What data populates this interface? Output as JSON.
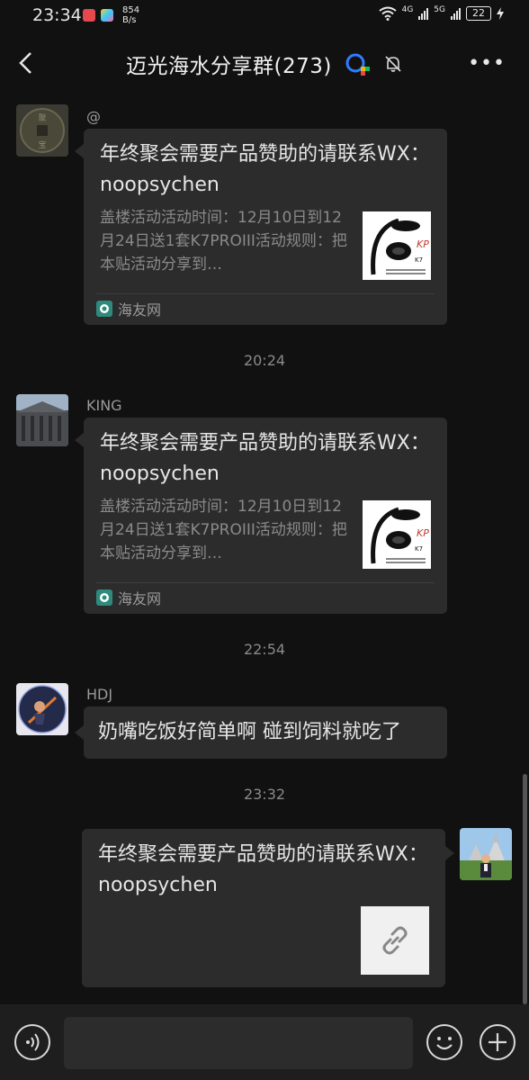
{
  "status": {
    "time": "23:34",
    "net_speed_value": "854",
    "net_speed_unit": "B/s",
    "sig1": "4G",
    "sig2": "5G",
    "battery": "22"
  },
  "header": {
    "title": "迈光海水分享群(273)"
  },
  "messages": [
    {
      "nick": "@",
      "card_title": "年终聚会需要产品赞助的请联系WX：noopsychen",
      "card_desc": "盖楼活动活动时间：12月10日到12月24日送1套K7PROIII活动规则：把本贴活动分享到…",
      "source": "海友网"
    },
    {
      "timestamp": "20:24",
      "nick": "KING",
      "card_title": "年终聚会需要产品赞助的请联系WX：noopsychen",
      "card_desc": "盖楼活动活动时间：12月10日到12月24日送1套K7PROIII活动规则：把本贴活动分享到…",
      "source": "海友网"
    },
    {
      "timestamp": "22:54",
      "nick": "HDJ",
      "text": "奶嘴吃饭好简单啊 碰到饲料就吃了"
    },
    {
      "timestamp": "23:32",
      "card_title": "年终聚会需要产品赞助的请联系WX：noopsychen"
    }
  ],
  "thumb_text": {
    "brand": "K7",
    "caption": "云霞器 卡7 对照\n微信用人商业分享用户"
  },
  "colors": {
    "background": "#111111",
    "bubble": "#2c2c2c",
    "input_bar": "#1e1e1e",
    "accent_green": "#07c160"
  }
}
